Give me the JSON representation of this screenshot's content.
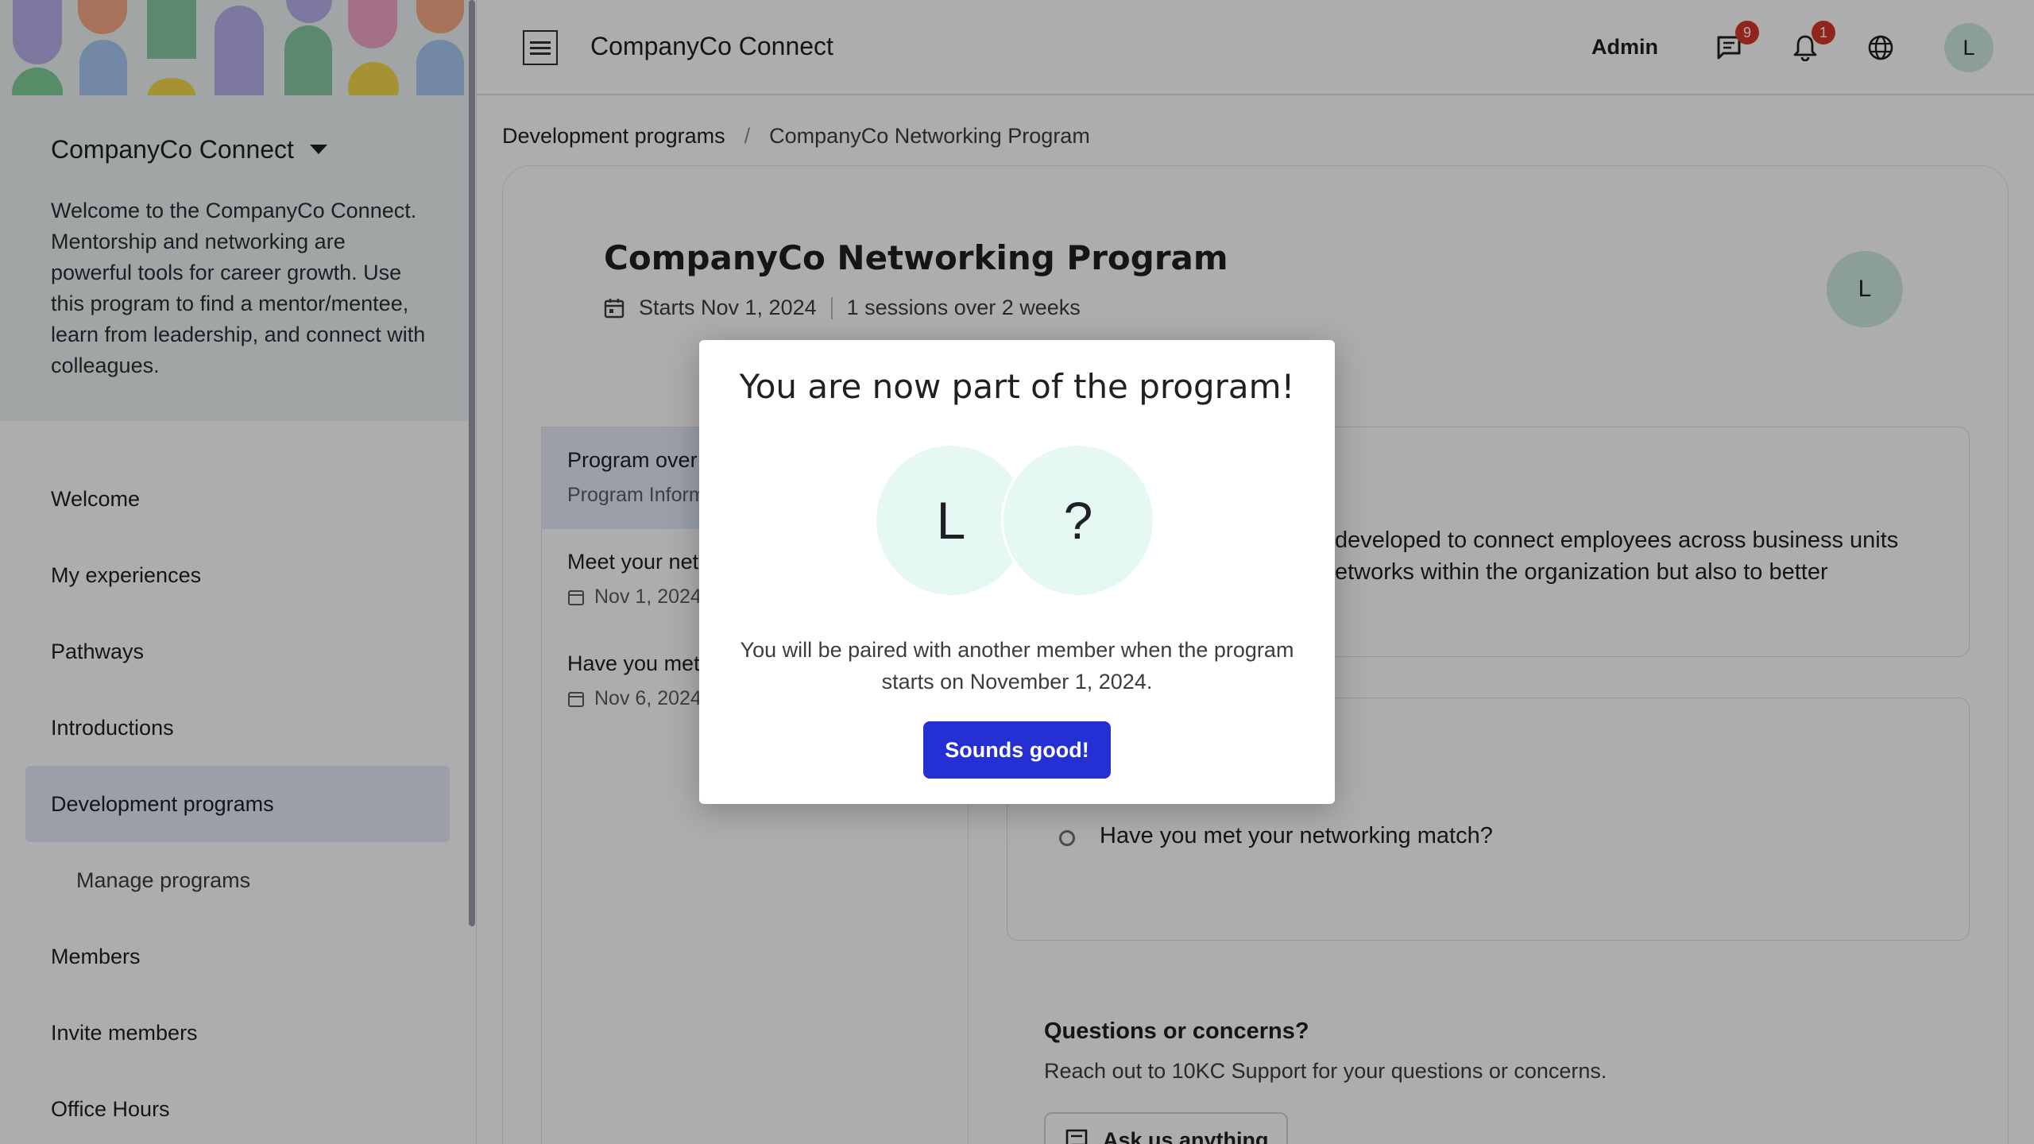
{
  "app": {
    "title": "CompanyCo Connect"
  },
  "sidebar": {
    "brand": "CompanyCo Connect",
    "welcome": "Welcome to the CompanyCo Connect. Mentorship and networking are powerful tools for career growth. Use this program to find a mentor/mentee, learn from leadership, and connect with colleagues.",
    "items": [
      {
        "label": "Welcome",
        "active": false
      },
      {
        "label": "My experiences",
        "active": false
      },
      {
        "label": "Pathways",
        "active": false
      },
      {
        "label": "Introductions",
        "active": false
      },
      {
        "label": "Development programs",
        "active": true
      },
      {
        "label": "Manage programs",
        "active": false,
        "sub": true
      },
      {
        "label": "Members",
        "active": false
      },
      {
        "label": "Invite members",
        "active": false
      },
      {
        "label": "Office Hours",
        "active": false
      }
    ]
  },
  "topbar": {
    "admin_label": "Admin",
    "messages_badge": "9",
    "notifications_badge": "1",
    "user_initial": "L"
  },
  "breadcrumb": {
    "parent": "Development programs",
    "separator": "/",
    "current": "CompanyCo Networking Program"
  },
  "program": {
    "title": "CompanyCo Networking Program",
    "starts": "Starts Nov 1, 2024",
    "sessions": "1 sessions over 2 weeks",
    "owner_initial": "L"
  },
  "sessions": [
    {
      "title": "Program over",
      "sub": "Program Inform",
      "active": true,
      "has_date_icon": false
    },
    {
      "title": "Meet your net",
      "sub": "Nov 1, 2024",
      "active": false,
      "has_date_icon": true
    },
    {
      "title": "Have you met",
      "sub": "Nov 6, 2024",
      "active": false,
      "has_date_icon": true
    }
  ],
  "overview": {
    "line1": "developed to connect employees across business units",
    "line2": "etworks within the organization but also to better"
  },
  "session_checklist": {
    "label": "Have you met your networking match?"
  },
  "questions": {
    "title": "Questions or concerns?",
    "text": "Reach out to 10KC Support for your questions or concerns.",
    "ask_label": "Ask us anything"
  },
  "modal": {
    "title": "You are now part of the program!",
    "user_initial": "L",
    "match_initial": "?",
    "text": "You will be paired with another member when the program starts on November 1, 2024.",
    "button": "Sounds good!"
  },
  "colors": {
    "accent": "#2430d4",
    "badge": "#d9352b",
    "avatar_bg": "#cfe9e3",
    "active_nav_bg": "#e4ebfb"
  }
}
